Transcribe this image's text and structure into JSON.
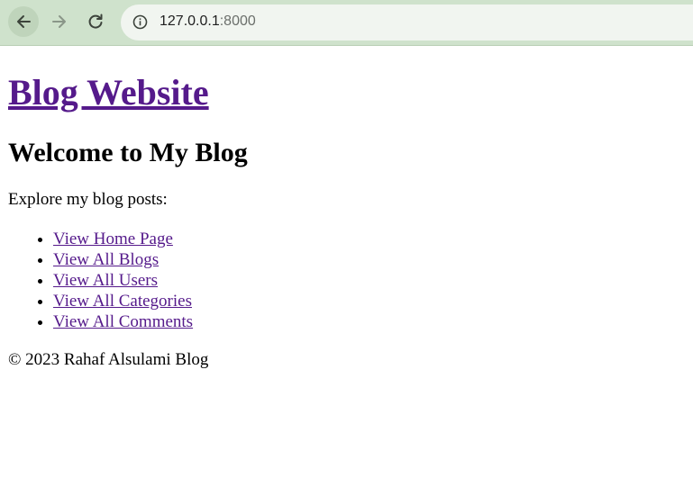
{
  "browser": {
    "url_host": "127.0.0.1",
    "url_port": ":8000",
    "icons": {
      "back": "arrow-left-icon",
      "forward": "arrow-right-icon",
      "reload": "reload-icon",
      "info": "info-icon"
    }
  },
  "page": {
    "site_title": "Blog Website",
    "welcome_heading": "Welcome to My Blog",
    "intro_text": "Explore my blog posts:",
    "links": [
      {
        "label": "View Home Page"
      },
      {
        "label": "View All Blogs"
      },
      {
        "label": "View All Users"
      },
      {
        "label": "View All Categories"
      },
      {
        "label": "View All Comments"
      }
    ],
    "footer_text": "© 2023 Rahaf Alsulami Blog"
  },
  "colors": {
    "toolbar_bg": "#cfe2cc",
    "omnibox_bg": "#f1f5f0",
    "link_visited": "#551a8b"
  }
}
